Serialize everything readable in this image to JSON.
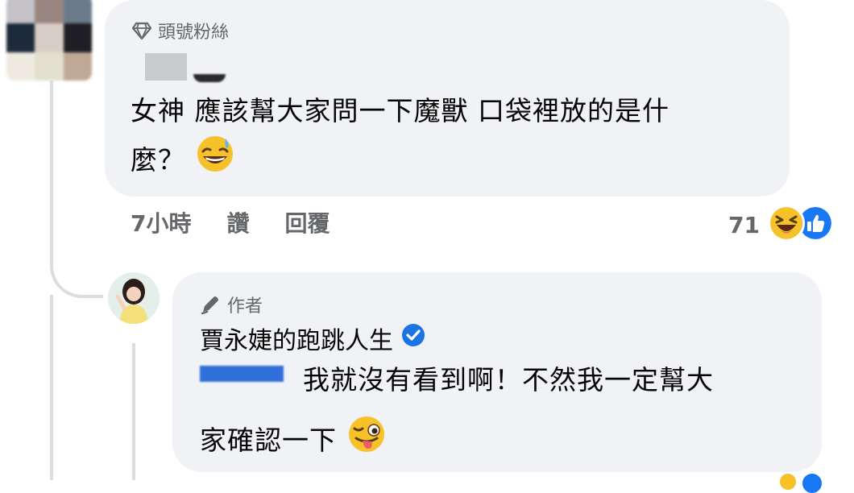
{
  "comment": {
    "badge_label": "頭號粉絲",
    "text_line1": "女神 應該幫大家問一下魔獸 口袋裡放的是什",
    "text_line2": "麼？",
    "time": "7小時",
    "like_label": "讚",
    "reply_label": "回覆",
    "reaction_count": "71",
    "reaction_icons": [
      "laughing-emoji",
      "like-thumb"
    ]
  },
  "reply": {
    "badge_label": "作者",
    "author_name": "賈永婕的跑跳人生",
    "text_line1": "我就沒有看到啊！不然我一定幫大",
    "text_line2": "家確認一下",
    "colors": {
      "verified": "#1b74e4",
      "like_blue": "#1877f2",
      "bubble": "#f0f2f5"
    }
  }
}
